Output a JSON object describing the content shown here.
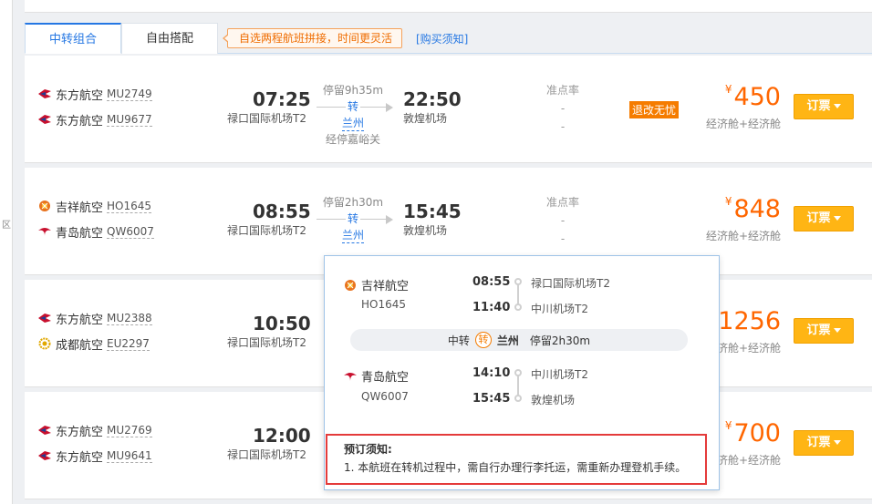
{
  "left_glyph": "区",
  "tabs": {
    "active": "中转组合",
    "inactive": "自由搭配"
  },
  "promo": "自选两程航班拼接，时间更灵活",
  "buy_notice_link": "[购买须知]",
  "flights": [
    {
      "leg1": {
        "airline": "东方航空",
        "flight_no": "MU2749"
      },
      "leg2": {
        "airline": "东方航空",
        "flight_no": "MU9677"
      },
      "dep_time": "07:25",
      "dep_airport": "禄口国际机场T2",
      "stop_duration": "停留9h35m",
      "transfer": "转",
      "stop_city": "兰州",
      "via": "经停嘉峪关",
      "arr_time": "22:50",
      "arr_airport": "敦煌机场",
      "ontime_label": "准点率",
      "ontime_v1": "-",
      "ontime_v2": "-",
      "badge": "退改无忧",
      "currency": "¥",
      "price": "450",
      "cabin": "经济舱+经济舱",
      "book": "订票"
    },
    {
      "leg1": {
        "airline": "吉祥航空",
        "flight_no": "HO1645"
      },
      "leg2": {
        "airline": "青岛航空",
        "flight_no": "QW6007"
      },
      "dep_time": "08:55",
      "dep_airport": "禄口国际机场T2",
      "stop_duration": "停留2h30m",
      "transfer": "转",
      "stop_city": "兰州",
      "arr_time": "15:45",
      "arr_airport": "敦煌机场",
      "ontime_label": "准点率",
      "ontime_v1": "-",
      "ontime_v2": "-",
      "currency": "¥",
      "price": "848",
      "cabin": "经济舱+经济舱",
      "book": "订票"
    },
    {
      "leg1": {
        "airline": "东方航空",
        "flight_no": "MU2388"
      },
      "leg2": {
        "airline": "成都航空",
        "flight_no": "EU2297"
      },
      "dep_time": "10:50",
      "dep_airport": "禄口国际机场T2",
      "price": "1256",
      "cabin": "济舱+经济舱",
      "book": "订票"
    },
    {
      "leg1": {
        "airline": "东方航空",
        "flight_no": "MU2769"
      },
      "leg2": {
        "airline": "东方航空",
        "flight_no": "MU9641"
      },
      "dep_time": "12:00",
      "dep_airport": "禄口国际机场T2",
      "currency": "¥",
      "price": "700",
      "cabin": "济舱+经济舱",
      "book": "订票"
    }
  ],
  "popup": {
    "seg1": {
      "airline": "吉祥航空",
      "flight_no": "HO1645",
      "dep_time": "08:55",
      "dep_airport": "禄口国际机场T2",
      "arr_time": "11:40",
      "arr_airport": "中川机场T2"
    },
    "transfer": {
      "label": "中转",
      "icon_text": "转",
      "city": "兰州",
      "stay": "停留2h30m"
    },
    "seg2": {
      "airline": "青岛航空",
      "flight_no": "QW6007",
      "dep_time": "14:10",
      "dep_airport": "中川机场T2",
      "arr_time": "15:45",
      "arr_airport": "敦煌机场"
    },
    "notice_title": "预订须知:",
    "notice_text": "1. 本航班在转机过程中，需自行办理行李托运，需重新办理登机手续。"
  },
  "colors": {
    "accent_blue": "#2577e3",
    "price_orange": "#ff6600",
    "book_button": "#ffb514",
    "notice_border": "#e43b3b",
    "eastern_red": "#c8102e",
    "eastern_blue": "#1c3f94",
    "juneyao": "#e8731f",
    "qingdao": "#c8102e",
    "chengdu": "#e0a800"
  },
  "icons": {
    "eastern": "china-eastern-logo-icon",
    "juneyao": "juneyao-logo-icon",
    "qingdao": "qingdao-logo-icon",
    "chengdu": "chengdu-logo-icon"
  }
}
